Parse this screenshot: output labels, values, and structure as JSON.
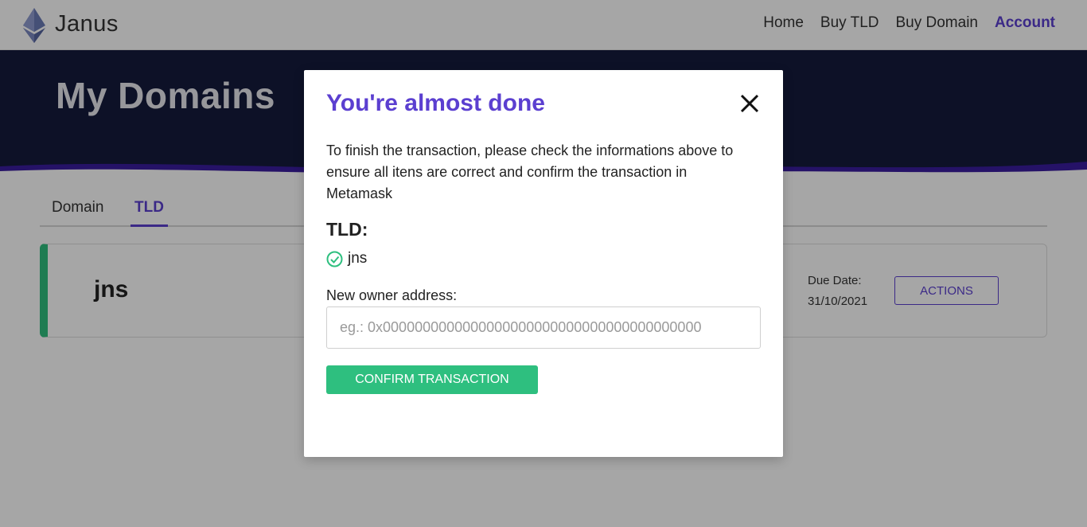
{
  "header": {
    "brand": "Janus",
    "logo_icon": "ethereum-diamond-icon",
    "nav": [
      {
        "label": "Home"
      },
      {
        "label": "Buy TLD"
      },
      {
        "label": "Buy Domain"
      },
      {
        "label": "Account",
        "active": true
      }
    ]
  },
  "hero": {
    "title": "My Domains"
  },
  "tabs": [
    {
      "label": "Domain"
    },
    {
      "label": "TLD",
      "active": true
    }
  ],
  "card": {
    "name": "jns",
    "due_label": "Due Date:",
    "due_value": "31/10/2021",
    "actions_label": "ACTIONS"
  },
  "modal": {
    "title": "You're almost done",
    "description": "To finish the transaction, please check the informations above to ensure all itens are correct and confirm the transaction in Metamask",
    "tld_label": "TLD:",
    "tld_value": "jns",
    "owner_label": "New owner address:",
    "owner_placeholder": "eg.: 0x0000000000000000000000000000000000000000",
    "confirm_label": "CONFIRM TRANSACTION"
  },
  "colors": {
    "accent": "#5b3fd0",
    "success": "#2ebf7f",
    "hero_bg": "#141b3d"
  }
}
